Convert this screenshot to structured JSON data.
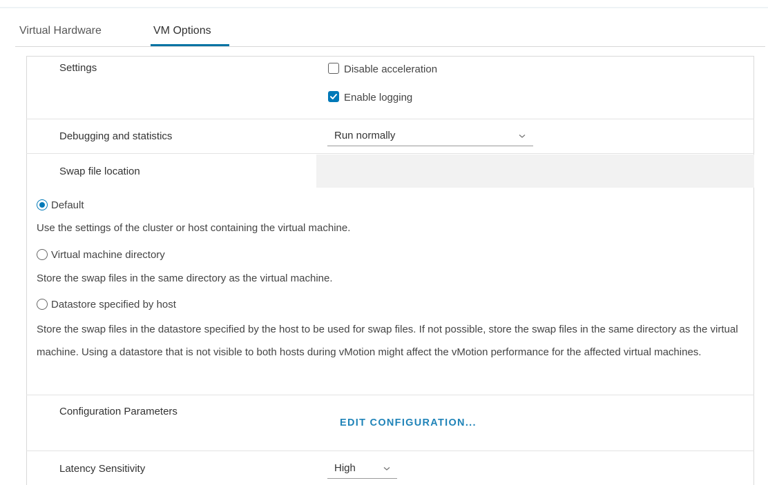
{
  "tabs": [
    {
      "label": "Virtual Hardware",
      "active": false
    },
    {
      "label": "VM Options",
      "active": true
    }
  ],
  "settings": {
    "label": "Settings",
    "disable_acceleration": {
      "label": "Disable acceleration",
      "checked": false
    },
    "enable_logging": {
      "label": "Enable logging",
      "checked": true
    }
  },
  "debugging": {
    "label": "Debugging and statistics",
    "value": "Run normally"
  },
  "swap": {
    "label": "Swap file location",
    "options": [
      {
        "label": "Default",
        "checked": true,
        "description": "Use the settings of the cluster or host containing the virtual machine."
      },
      {
        "label": "Virtual machine directory",
        "checked": false,
        "description": "Store the swap files in the same directory as the virtual machine."
      },
      {
        "label": "Datastore specified by host",
        "checked": false,
        "description": "Store the swap files in the datastore specified by the host to be used for swap files. If not possible, store the swap files in the same directory as the virtual machine. Using a datastore that is not visible to both hosts during vMotion might affect the vMotion performance for the affected virtual machines."
      }
    ]
  },
  "config_params": {
    "label": "Configuration Parameters",
    "button": "EDIT CONFIGURATION..."
  },
  "latency": {
    "label": "Latency Sensitivity",
    "value": "High"
  },
  "colors": {
    "accent": "#0079b8",
    "link": "#1f83b8",
    "tab_underline": "#0072a3"
  }
}
